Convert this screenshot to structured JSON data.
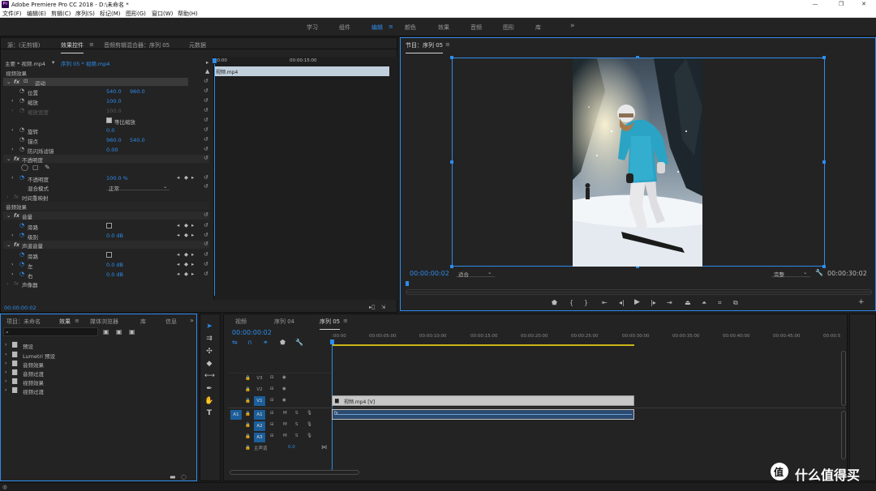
{
  "window": {
    "title": "Adobe Premiere Pro CC 2018 - D:\\未命名 *",
    "logo_text": "Pr",
    "minimize": "—",
    "maximize": "❐",
    "close": "✕"
  },
  "menu": [
    "文件(F)",
    "编辑(E)",
    "剪辑(C)",
    "序列(S)",
    "标记(M)",
    "图形(G)",
    "窗口(W)",
    "帮助(H)"
  ],
  "workspaces": {
    "items": [
      "学习",
      "组件",
      "编辑",
      "颜色",
      "效果",
      "音频",
      "图形",
      "库"
    ],
    "active": "编辑",
    "more": "»"
  },
  "effect_controls": {
    "tabs": [
      "源：(无剪辑)",
      "效果控件",
      "音频剪辑混合器：序列 05",
      "元数据"
    ],
    "master_clip": "主要 * 视频.mp4",
    "sequence_clip": "序列 05 * 视频.mp4",
    "ruler_start": "00:00",
    "ruler_mid": "00:00:15:00",
    "clip_label": "视频.mp4",
    "video_effects": "视频效果",
    "motion": "运动",
    "position": {
      "label": "位置",
      "x": "540.0",
      "y": "960.0"
    },
    "scale": {
      "label": "缩放",
      "value": "100.0"
    },
    "scale_width": {
      "label": "缩放宽度",
      "value": "100.0"
    },
    "uniform_scale": "等比缩放",
    "rotation": {
      "label": "旋转",
      "value": "0.0"
    },
    "anchor": {
      "label": "锚点",
      "x": "960.0",
      "y": "540.0"
    },
    "anti_flicker": {
      "label": "防闪烁滤镜",
      "value": "0.00"
    },
    "opacity_group": "不透明度",
    "opacity": {
      "label": "不透明度",
      "value": "100.0 %"
    },
    "blend_mode": {
      "label": "混合模式",
      "value": "正常"
    },
    "time_remap": "时间重映射",
    "audio_effects": "音频效果",
    "volume": "音量",
    "bypass": "旁路",
    "level": {
      "label": "级别",
      "value": "0.0 dB"
    },
    "channel_volume": "声道音量",
    "bypass2": "旁路",
    "left": {
      "label": "左",
      "value": "0.0 dB"
    },
    "right": {
      "label": "右",
      "value": "0.0 dB"
    },
    "panner": "声像器",
    "timecode": "00:00:00:02"
  },
  "program": {
    "title": "节目：序列 05",
    "timecode": "00:00:00:02",
    "fit": "适合",
    "quality": "完整",
    "duration": "00:00:30:02"
  },
  "project": {
    "tabs": [
      "项目：未命名",
      "效果",
      "媒体浏览器",
      "库",
      "信息"
    ],
    "more": "»",
    "items": [
      "预设",
      "Lumetri 预设",
      "音频效果",
      "音频过渡",
      "视频效果",
      "视频过渡"
    ]
  },
  "timeline": {
    "tabs": [
      "视频",
      "序列 04",
      "序列 05"
    ],
    "timecode": "00:00:00:02",
    "ruler": [
      ":00:00",
      "00:00:05:00",
      "00:00:10:00",
      "00:00:15:00",
      "00:00:20:00",
      "00:00:25:00",
      "00:00:30:00",
      "00:00:35:00",
      "00:00:40:00",
      "00:00:45:00",
      "00:00:5"
    ],
    "tracks": {
      "v3": "V3",
      "v2": "V2",
      "v1": "V1",
      "a1": "A1",
      "a2": "A2",
      "a3": "A3",
      "a1_src": "A1",
      "master": "主声道",
      "master_val": "0.0",
      "mute": "M",
      "solo": "S"
    },
    "video_clip": "视频.mp4 [V]"
  },
  "watermark": "什么值得买",
  "watermark_icon": "值",
  "colors": {
    "accent": "#2d8ceb",
    "bg": "#232323",
    "playhead": "#2d8ceb"
  }
}
